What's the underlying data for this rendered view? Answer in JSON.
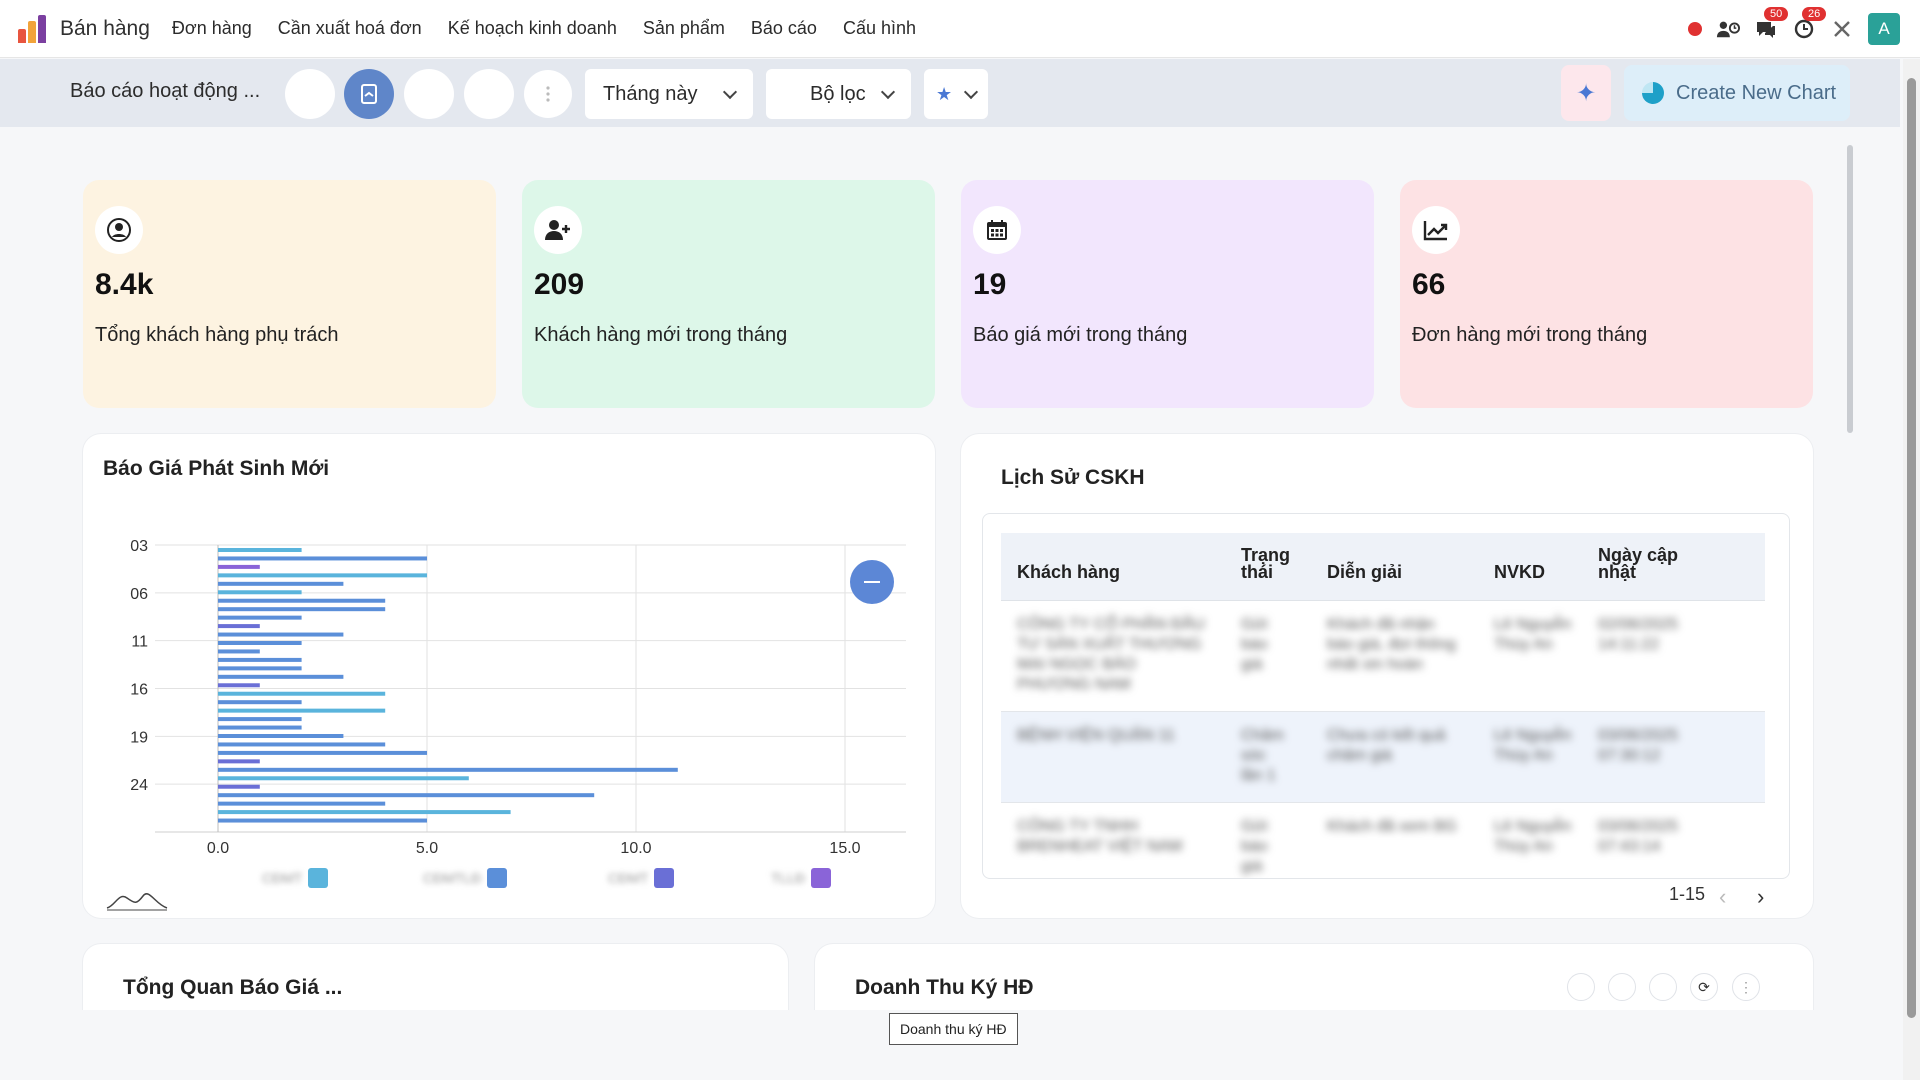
{
  "app": {
    "title": "Bán hàng",
    "menu": [
      "Đơn hàng",
      "Cần xuất hoá đơn",
      "Kế hoạch kinh doanh",
      "Sản phẩm",
      "Báo cáo",
      "Cấu hình"
    ],
    "messages_badge": "50",
    "activities_badge": "26",
    "avatar_letter": "A"
  },
  "toolbar": {
    "breadcrumb": "Báo cáo hoạt động ...",
    "period": "Tháng này",
    "filter": "Bộ lọc",
    "create_chart": "Create New Chart"
  },
  "kpis": [
    {
      "value": "8.4k",
      "label": "Tổng khách hàng phụ trách",
      "icon": "user-circle-icon",
      "color": "#fdf3e1"
    },
    {
      "value": "209",
      "label": "Khách hàng mới trong tháng",
      "icon": "user-plus-icon",
      "color": "#ddf7e9"
    },
    {
      "value": "19",
      "label": "Báo giá mới trong tháng",
      "icon": "calendar-icon",
      "color": "#f2e6fd"
    },
    {
      "value": "66",
      "label": "Đơn hàng mới trong tháng",
      "icon": "trend-chart-icon",
      "color": "#fde2e4"
    }
  ],
  "quote_chart": {
    "title": "Báo Giá Phát Sinh Mới"
  },
  "chart_data": {
    "type": "bar",
    "orientation": "horizontal",
    "title": "Báo Giá Phát Sinh Mới",
    "xlim": [
      0,
      16.5
    ],
    "x_ticks": [
      "0.0",
      "5.0",
      "10.0",
      "15.0"
    ],
    "y_ticks": [
      "03",
      "06",
      "11",
      "16",
      "19",
      "24"
    ],
    "series": [
      {
        "name": "CĐMT",
        "color": "#5ab4dc"
      },
      {
        "name": "CĐMTLĐ",
        "color": "#5b8fd9"
      },
      {
        "name": "CĐMT",
        "color": "#6a6fd6"
      },
      {
        "name": "TLLĐ",
        "color": "#8a64d8"
      }
    ],
    "bars": [
      {
        "value": 2.0,
        "series": 0
      },
      {
        "value": 5.0,
        "series": 1
      },
      {
        "value": 1.0,
        "series": 3
      },
      {
        "value": 5.0,
        "series": 0
      },
      {
        "value": 3.0,
        "series": 1
      },
      {
        "value": 2.0,
        "series": 0
      },
      {
        "value": 4.0,
        "series": 1
      },
      {
        "value": 4.0,
        "series": 1
      },
      {
        "value": 2.0,
        "series": 1
      },
      {
        "value": 1.0,
        "series": 2
      },
      {
        "value": 3.0,
        "series": 1
      },
      {
        "value": 2.0,
        "series": 1
      },
      {
        "value": 1.0,
        "series": 1
      },
      {
        "value": 2.0,
        "series": 1
      },
      {
        "value": 2.0,
        "series": 1
      },
      {
        "value": 3.0,
        "series": 1
      },
      {
        "value": 1.0,
        "series": 2
      },
      {
        "value": 4.0,
        "series": 0
      },
      {
        "value": 2.0,
        "series": 1
      },
      {
        "value": 4.0,
        "series": 0
      },
      {
        "value": 2.0,
        "series": 1
      },
      {
        "value": 2.0,
        "series": 1
      },
      {
        "value": 3.0,
        "series": 1
      },
      {
        "value": 4.0,
        "series": 1
      },
      {
        "value": 5.0,
        "series": 1
      },
      {
        "value": 1.0,
        "series": 2
      },
      {
        "value": 11.0,
        "series": 1
      },
      {
        "value": 6.0,
        "series": 0
      },
      {
        "value": 1.0,
        "series": 2
      },
      {
        "value": 9.0,
        "series": 1
      },
      {
        "value": 4.0,
        "series": 1
      },
      {
        "value": 7.0,
        "series": 0
      },
      {
        "value": 5.0,
        "series": 1
      }
    ],
    "grid": true,
    "legend_position": "bottom"
  },
  "history": {
    "title": "Lịch Sử CSKH",
    "columns": [
      "Khách hàng",
      "Trạng thái",
      "Diễn giải",
      "NVKD",
      "Ngày cập nhật"
    ],
    "rows": [
      [
        "CÔNG TY CỔ PHẦN ĐẦU TƯ SẢN XUẤT THƯƠNG MẠI NGỌC BẢO PHƯƠNG NAM",
        "Gửi báo giá",
        "Khách đã nhận báo giá, đợi thông nhất xin hoàn",
        "Lê Nguyễn Thùy An",
        "02/06/2025 14:11:22"
      ],
      [
        "BỆNH VIỆN QUẬN 11",
        "Chăm sóc lần 1",
        "Chưa có kết quả chăm giá",
        "Lê Nguyễn Thùy An",
        "03/06/2025 07:30:12"
      ],
      [
        "CÔNG TY TNHH BRENHEAT VIỆT NAM",
        "Gửi báo giá",
        "Khách đã xem BG",
        "Lê Nguyễn Thùy An",
        "03/06/2025 07:43:14"
      ]
    ],
    "pagination": "1-15"
  },
  "bottom": {
    "quote_overview_title": "Tổng Quan Báo Giá ...",
    "revenue_title": "Doanh Thu Ký HĐ",
    "tooltip": "Doanh thu ký HĐ"
  }
}
